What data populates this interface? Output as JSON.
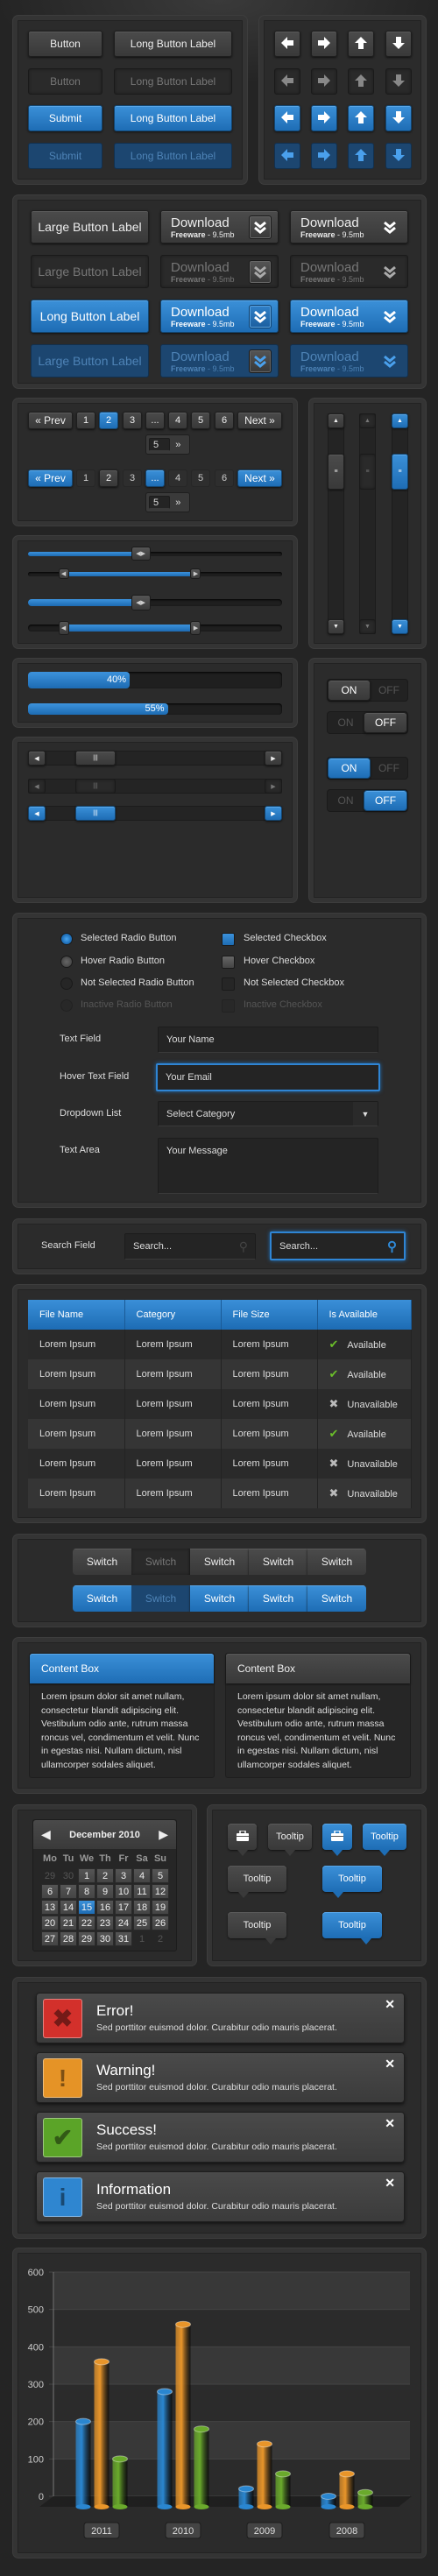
{
  "buttons": {
    "rows": [
      [
        "Button",
        "Long Button Label"
      ],
      [
        "Button",
        "Long Button Label"
      ],
      [
        "Submit",
        "Long Button Label"
      ],
      [
        "Submit",
        "Long Button Label"
      ]
    ],
    "states": [
      "normal",
      "inactive",
      "active",
      "active-inactive"
    ]
  },
  "arrow_buttons": {
    "icons": [
      "arrow-left",
      "arrow-right",
      "arrow-up",
      "arrow-down"
    ]
  },
  "large_buttons": {
    "labels": [
      "Large Button Label",
      "Large Button Label",
      "Long Button Label",
      "Large Button Label"
    ],
    "download": {
      "title": "Download",
      "type": "Freeware",
      "size": " - 9.5mb"
    }
  },
  "pagination": {
    "prev": "« Prev",
    "next": "Next »",
    "pages": [
      "1",
      "2",
      "3",
      "...",
      "4",
      "5",
      "6"
    ],
    "current_page": "2",
    "popup_value": "5",
    "popup_go": "»"
  },
  "sliders": {
    "single_value": 0.44,
    "range_value": [
      0.14,
      0.66
    ]
  },
  "progress": [
    {
      "label": "40%",
      "value": 40
    },
    {
      "label": "55%",
      "value": 55
    }
  ],
  "toggles": {
    "on": "ON",
    "off": "OFF",
    "states": [
      "on",
      "off",
      "on",
      "off"
    ]
  },
  "form": {
    "radios": [
      "Selected Radio Button",
      "Hover Radio Button",
      "Not Selected Radio Button",
      "Inactive Radio Button"
    ],
    "checkboxes": [
      "Selected Checkbox",
      "Hover Checkbox",
      "Not Selected Checkbox",
      "Inactive Checkbox"
    ],
    "text_field": {
      "label": "Text Field",
      "value": "Your Name"
    },
    "hover_text_field": {
      "label": "Hover Text Field",
      "value": "Your Email"
    },
    "dropdown": {
      "label": "Dropdown List",
      "value": "Select Category"
    },
    "text_area": {
      "label": "Text Area",
      "value": "Your Message"
    }
  },
  "search": {
    "label": "Search Field",
    "placeholder": "Search..."
  },
  "table": {
    "headers": [
      "File Name",
      "Category",
      "File Size",
      "Is Available"
    ],
    "rows": [
      [
        "Lorem Ipsum",
        "Lorem Ipsum",
        "Lorem Ipsum",
        "Available"
      ],
      [
        "Lorem Ipsum",
        "Lorem Ipsum",
        "Lorem Ipsum",
        "Available"
      ],
      [
        "Lorem Ipsum",
        "Lorem Ipsum",
        "Lorem Ipsum",
        "Unavailable"
      ],
      [
        "Lorem Ipsum",
        "Lorem Ipsum",
        "Lorem Ipsum",
        "Available"
      ],
      [
        "Lorem Ipsum",
        "Lorem Ipsum",
        "Lorem Ipsum",
        "Unavailable"
      ],
      [
        "Lorem Ipsum",
        "Lorem Ipsum",
        "Lorem Ipsum",
        "Unavailable"
      ]
    ]
  },
  "switches": {
    "labels": [
      "Switch",
      "Switch",
      "Switch",
      "Switch",
      "Switch"
    ],
    "selected_index": 1
  },
  "content_boxes": [
    {
      "title": "Content Box",
      "body": "Lorem ipsum dolor sit amet nullam, consectetur blandit adipiscing elit. Vestibulum odio ante, rutrum massa roncus vel, condimentum et velit. Nunc in egestas nisi. Nullam dictum, nisl ullamcorper sodales aliquet."
    },
    {
      "title": "Content Box",
      "body": "Lorem ipsum dolor sit amet nullam, consectetur blandit adipiscing elit. Vestibulum odio ante, rutrum massa roncus vel, condimentum et velit. Nunc in egestas nisi. Nullam dictum, nisl ullamcorper sodales aliquet."
    }
  ],
  "calendar": {
    "month": "December 2010",
    "weekdays": [
      "Mo",
      "Tu",
      "We",
      "Th",
      "Fr",
      "Sa",
      "Su"
    ],
    "weeks": [
      [
        "29",
        "30",
        "1",
        "2",
        "3",
        "4",
        "5"
      ],
      [
        "6",
        "7",
        "8",
        "9",
        "10",
        "11",
        "12"
      ],
      [
        "13",
        "14",
        "15",
        "16",
        "17",
        "18",
        "19"
      ],
      [
        "20",
        "21",
        "22",
        "23",
        "24",
        "25",
        "26"
      ],
      [
        "27",
        "28",
        "29",
        "30",
        "31",
        "1",
        "2"
      ]
    ],
    "selected": "15"
  },
  "tooltips": {
    "label": "Tooltip",
    "icon": "toolbox-icon"
  },
  "alerts": [
    {
      "title": "Error!",
      "text": "Sed porttitor euismod dolor. Curabitur odio mauris placerat.",
      "icon": "✖",
      "color": "#d3302b"
    },
    {
      "title": "Warning!",
      "text": "Sed porttitor euismod dolor. Curabitur odio mauris placerat.",
      "icon": "!",
      "color": "#e59326"
    },
    {
      "title": "Success!",
      "text": "Sed porttitor euismod dolor. Curabitur odio mauris placerat.",
      "icon": "✔",
      "color": "#5ba428"
    },
    {
      "title": "Information",
      "text": "Sed porttitor euismod dolor. Curabitur odio mauris placerat.",
      "icon": "i",
      "color": "#2f86d0"
    }
  ],
  "alert_close": "✕",
  "colors": {
    "accent": "#2c7fcc",
    "panel": "#2b2b2b",
    "background": "#242424"
  },
  "chart_data": {
    "type": "bar",
    "categories": [
      "2011",
      "2010",
      "2009",
      "2008"
    ],
    "series": [
      {
        "color": "#2a86d0",
        "values": [
          200,
          280,
          20,
          0
        ]
      },
      {
        "color": "#e8952a",
        "values": [
          360,
          460,
          140,
          60
        ]
      },
      {
        "color": "#6aaa2c",
        "values": [
          100,
          180,
          60,
          10
        ]
      }
    ],
    "yticks": [
      "0",
      "100",
      "200",
      "300",
      "400",
      "500",
      "600"
    ],
    "ylim": [
      0,
      600
    ],
    "grid": true,
    "title": "",
    "xlabel": "",
    "ylabel": ""
  }
}
